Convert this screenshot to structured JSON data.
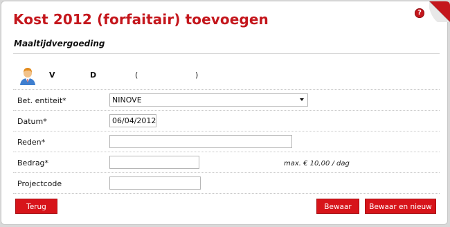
{
  "header": {
    "title": "Kost 2012 (forfaitair) toevoegen",
    "help_icon": "question-icon",
    "help_label": "?"
  },
  "section": {
    "subtitle": "Maaltijdvergoeding"
  },
  "employee": {
    "icon": "user-avatar-icon",
    "first_initial": "V",
    "second_initial": "D",
    "paren_open": "(",
    "paren_close": ")"
  },
  "form": {
    "entity_label": "Bet. entiteit*",
    "entity_value": "NINOVE",
    "date_label": "Datum*",
    "date_value": "06/04/2012",
    "reason_label": "Reden*",
    "reason_value": "",
    "amount_label": "Bedrag*",
    "amount_value": "",
    "amount_hint": "max. € 10,00 / dag",
    "project_label": "Projectcode",
    "project_value": ""
  },
  "buttons": {
    "back": "Terug",
    "save": "Bewaar",
    "save_new": "Bewaar en nieuw"
  },
  "colors": {
    "accent": "#d7141a",
    "title": "#c4161c"
  }
}
